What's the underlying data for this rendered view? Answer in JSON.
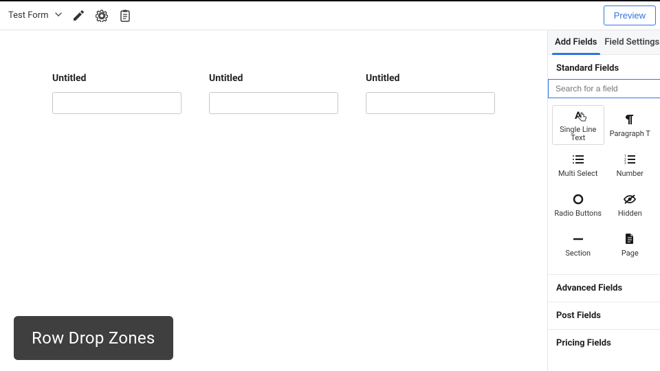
{
  "header": {
    "form_name": "Test Form",
    "preview_label": "Preview"
  },
  "canvas": {
    "fields": [
      {
        "label": "Untitled"
      },
      {
        "label": "Untitled"
      },
      {
        "label": "Untitled"
      }
    ]
  },
  "sidebar": {
    "tabs": {
      "add_fields": "Add Fields",
      "field_settings": "Field Settings"
    },
    "section_standard": "Standard Fields",
    "search_placeholder": "Search for a field",
    "tiles": {
      "single_line_text": "Single Line Text",
      "paragraph_text": "Paragraph T",
      "multi_select": "Multi Select",
      "number": "Number",
      "radio_buttons": "Radio Buttons",
      "hidden": "Hidden",
      "section": "Section",
      "page": "Page"
    },
    "collapsed": {
      "advanced": "Advanced Fields",
      "post": "Post Fields",
      "pricing": "Pricing Fields"
    }
  },
  "toast": {
    "text": "Row Drop Zones"
  }
}
